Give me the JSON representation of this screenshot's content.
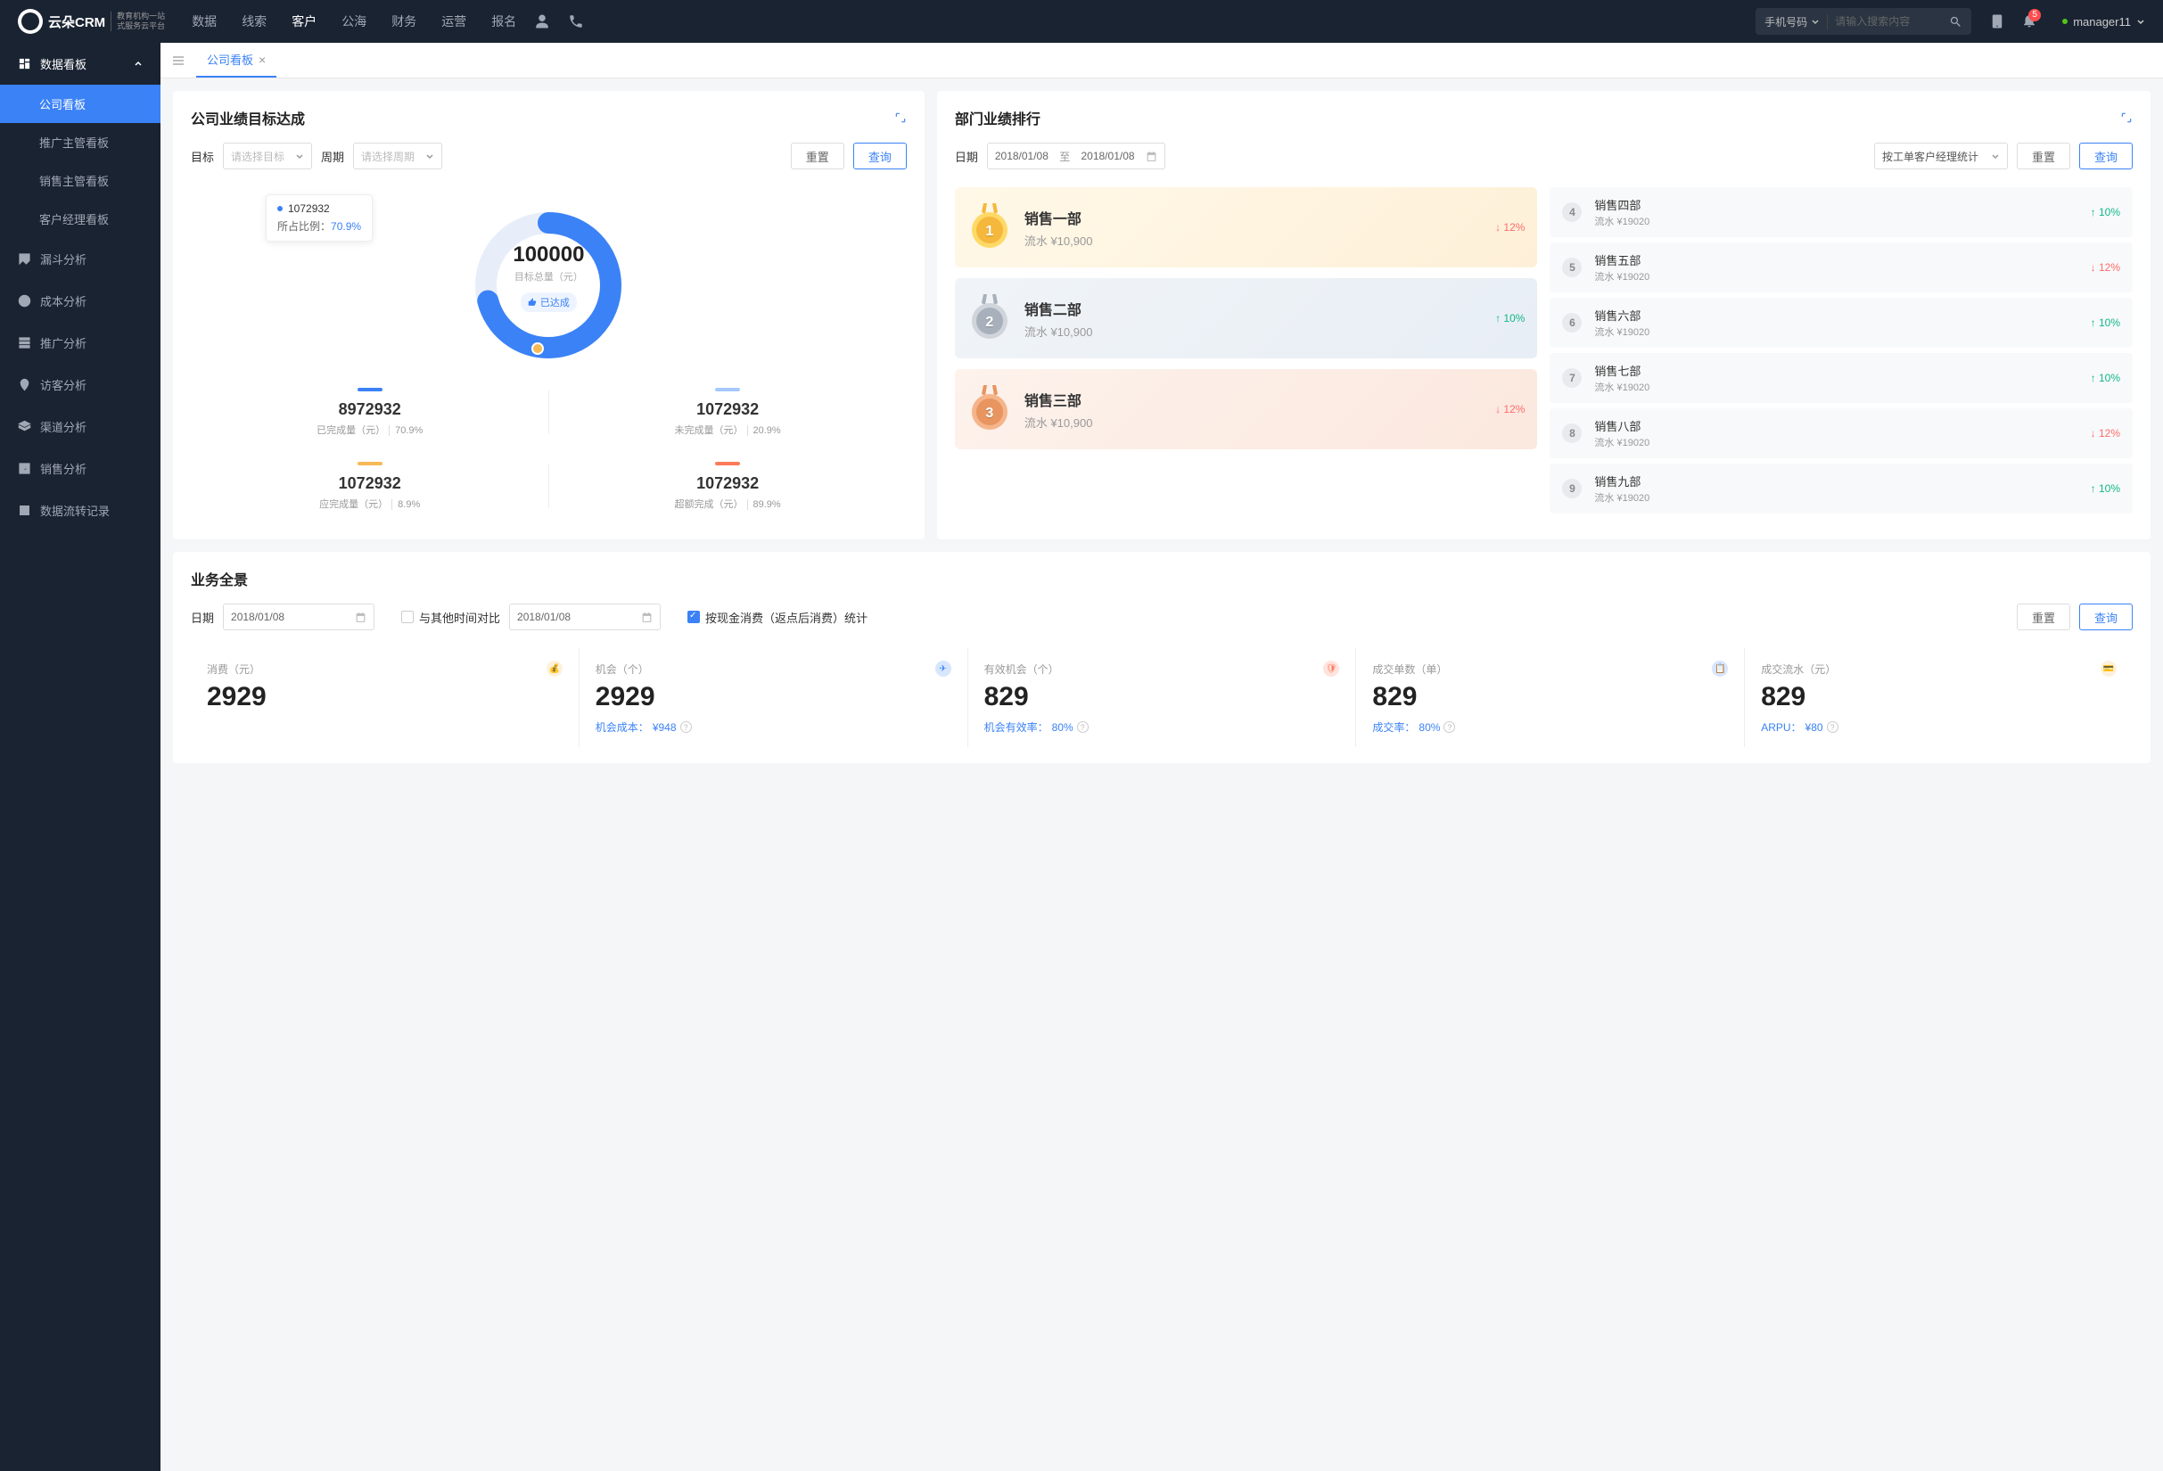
{
  "logo_text": "云朵CRM",
  "logo_sub": "教育机构一站\n式服务云平台",
  "nav": [
    {
      "label": "数据"
    },
    {
      "label": "线索"
    },
    {
      "label": "客户",
      "active": true
    },
    {
      "label": "公海"
    },
    {
      "label": "财务"
    },
    {
      "label": "运营"
    },
    {
      "label": "报名"
    }
  ],
  "search_type": "手机号码",
  "search_placeholder": "请输入搜索内容",
  "notif_count": "5",
  "username": "manager11",
  "sidebar": {
    "group1": "数据看板",
    "subs": [
      {
        "label": "公司看板",
        "active": true
      },
      {
        "label": "推广主管看板"
      },
      {
        "label": "销售主管看板"
      },
      {
        "label": "客户经理看板"
      }
    ],
    "items": [
      {
        "label": "漏斗分析"
      },
      {
        "label": "成本分析"
      },
      {
        "label": "推广分析"
      },
      {
        "label": "访客分析"
      },
      {
        "label": "渠道分析"
      },
      {
        "label": "销售分析"
      },
      {
        "label": "数据流转记录"
      }
    ]
  },
  "tab1": "公司看板",
  "panelA": {
    "title": "公司业绩目标达成",
    "target_lbl": "目标",
    "target_ph": "请选择目标",
    "period_lbl": "周期",
    "period_ph": "请选择周期",
    "reset": "重置",
    "query": "查询",
    "tooltip_val": "1072932",
    "tooltip_lbl": "所占比例：",
    "tooltip_pct": "70.9%",
    "total": "100000",
    "total_lbl": "目标总量（元）",
    "badge": "已达成",
    "stats": [
      {
        "color": "#3b82f6",
        "num": "8972932",
        "desc": "已完成量（元）",
        "pct": "70.9%"
      },
      {
        "color": "#a6c8ff",
        "num": "1072932",
        "desc": "未完成量（元）",
        "pct": "20.9%"
      },
      {
        "color": "#f7b955",
        "num": "1072932",
        "desc": "应完成量（元）",
        "pct": "8.9%"
      },
      {
        "color": "#ff7a59",
        "num": "1072932",
        "desc": "超额完成（元）",
        "pct": "89.9%"
      }
    ]
  },
  "panelB": {
    "title": "部门业绩排行",
    "date_lbl": "日期",
    "date_from": "2018/01/08",
    "date_to": "2018/01/08",
    "to": "至",
    "stat_by": "按工单客户经理统计",
    "reset": "重置",
    "query": "查询",
    "top3": [
      {
        "rank": "1",
        "name": "销售一部",
        "val": "流水 ¥10,900",
        "trend": "12%",
        "dir": "down"
      },
      {
        "rank": "2",
        "name": "销售二部",
        "val": "流水 ¥10,900",
        "trend": "10%",
        "dir": "up"
      },
      {
        "rank": "3",
        "name": "销售三部",
        "val": "流水 ¥10,900",
        "trend": "12%",
        "dir": "down"
      }
    ],
    "rest": [
      {
        "rank": "4",
        "name": "销售四部",
        "val": "流水 ¥19020",
        "trend": "10%",
        "dir": "up"
      },
      {
        "rank": "5",
        "name": "销售五部",
        "val": "流水 ¥19020",
        "trend": "12%",
        "dir": "down"
      },
      {
        "rank": "6",
        "name": "销售六部",
        "val": "流水 ¥19020",
        "trend": "10%",
        "dir": "up"
      },
      {
        "rank": "7",
        "name": "销售七部",
        "val": "流水 ¥19020",
        "trend": "10%",
        "dir": "up"
      },
      {
        "rank": "8",
        "name": "销售八部",
        "val": "流水 ¥19020",
        "trend": "12%",
        "dir": "down"
      },
      {
        "rank": "9",
        "name": "销售九部",
        "val": "流水 ¥19020",
        "trend": "10%",
        "dir": "up"
      }
    ]
  },
  "panelC": {
    "title": "业务全景",
    "date_lbl": "日期",
    "date1": "2018/01/08",
    "compare_lbl": "与其他时间对比",
    "date2": "2018/01/08",
    "ck_lbl": "按现金消费（返点后消费）统计",
    "reset": "重置",
    "query": "查询",
    "cards": [
      {
        "label": "消费（元）",
        "num": "2929",
        "sub": "",
        "subval": "",
        "color": "#f7b955"
      },
      {
        "label": "机会（个）",
        "num": "2929",
        "sub": "机会成本：",
        "subval": "¥948",
        "color": "#3b82f6"
      },
      {
        "label": "有效机会（个）",
        "num": "829",
        "sub": "机会有效率：",
        "subval": "80%",
        "color": "#ff7a59"
      },
      {
        "label": "成交单数（单）",
        "num": "829",
        "sub": "成交率：",
        "subval": "80%",
        "color": "#3b82f6"
      },
      {
        "label": "成交流水（元）",
        "num": "829",
        "sub": "ARPU：",
        "subval": "¥80",
        "color": "#f7b955"
      }
    ]
  },
  "chart_data": {
    "type": "pie",
    "title": "目标总量（元）",
    "total": 100000,
    "series": [
      {
        "name": "已完成量（元）",
        "value": 8972932,
        "pct": 70.9,
        "color": "#3b82f6"
      },
      {
        "name": "未完成量（元）",
        "value": 1072932,
        "pct": 20.9,
        "color": "#a6c8ff"
      },
      {
        "name": "应完成量（元）",
        "value": 1072932,
        "pct": 8.9,
        "color": "#f7b955"
      },
      {
        "name": "超额完成（元）",
        "value": 1072932,
        "pct": 89.9,
        "color": "#ff7a59"
      }
    ]
  }
}
